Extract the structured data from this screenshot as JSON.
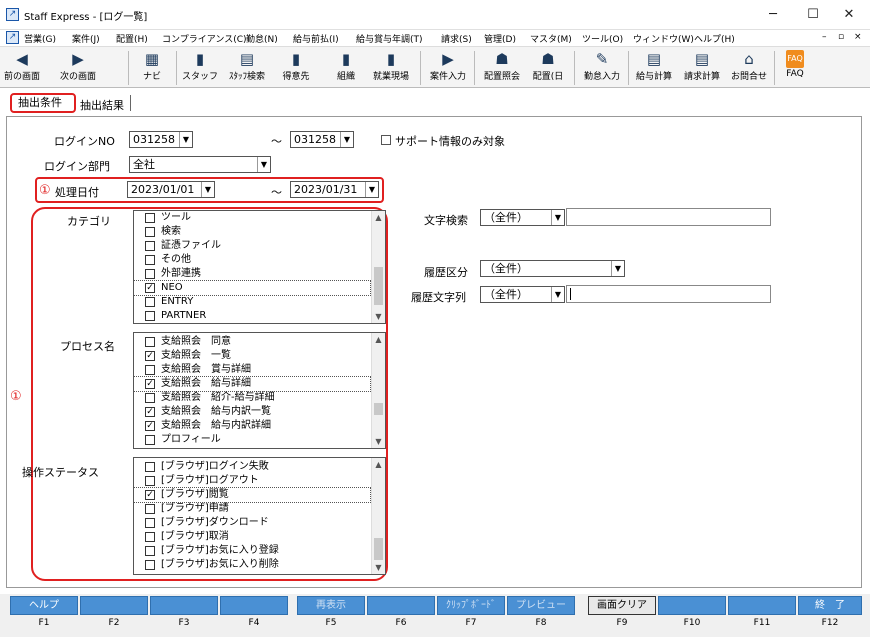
{
  "window": {
    "title": "Staff Express - [ログ一覧]",
    "minimize": "─",
    "maximize": "☐",
    "close": "✕"
  },
  "menu": [
    "営業(G)",
    "案件(J)",
    "配置(H)",
    "コンプライアンス(C)",
    "勤怠(N)",
    "給与前払(I)",
    "給与賞与年調(T)",
    "請求(S)",
    "管理(D)",
    "マスタ(M)",
    "ツール(O)",
    "ウィンドウ(W)",
    "ヘルプ(H)"
  ],
  "mdi_controls": [
    "–",
    "▫",
    "×"
  ],
  "toolbar": [
    {
      "label": "前の画面",
      "icon": "back-arrow-icon",
      "glyph": "◀"
    },
    {
      "label": "次の画面",
      "icon": "forward-arrow-icon",
      "glyph": "▶"
    },
    {
      "label": "ナビ",
      "icon": "navigator-icon",
      "glyph": "▦"
    },
    {
      "label": "スタッフ",
      "icon": "staff-icon",
      "glyph": "▮"
    },
    {
      "label": "ｽﾀｯﾌ検索",
      "icon": "staff-search-icon",
      "glyph": "▤"
    },
    {
      "label": "得意先",
      "icon": "customer-icon",
      "glyph": "▮"
    },
    {
      "label": "組織",
      "icon": "organization-icon",
      "glyph": "▮"
    },
    {
      "label": "就業現場",
      "icon": "workplace-icon",
      "glyph": "▮"
    },
    {
      "label": "案件入力",
      "icon": "case-entry-icon",
      "glyph": "▶"
    },
    {
      "label": "配置照会",
      "icon": "assignment-inquiry-icon",
      "glyph": "☗"
    },
    {
      "label": "配置(日",
      "icon": "daily-assignment-icon",
      "glyph": "☗"
    },
    {
      "label": "勤怠入力",
      "icon": "attendance-entry-icon",
      "glyph": "✎"
    },
    {
      "label": "給与計算",
      "icon": "payroll-calc-icon",
      "glyph": "▤"
    },
    {
      "label": "請求計算",
      "icon": "billing-calc-icon",
      "glyph": "▤"
    },
    {
      "label": "お問合せ",
      "icon": "inquiry-icon",
      "glyph": "⌂"
    },
    {
      "label": "FAQ",
      "icon": "faq-icon",
      "glyph": "FAQ"
    }
  ],
  "tabs": {
    "active": "抽出条件",
    "other": "抽出結果"
  },
  "form": {
    "login_no_label": "ログインNO",
    "login_no_from": "031258",
    "login_no_to": "031258",
    "tilde": "～",
    "support_label": "サポート情報のみ対象",
    "support_checked": false,
    "dept_label": "ログイン部門",
    "dept_value": "全社",
    "date_label": "処理日付",
    "date_from": "2023/01/01",
    "date_to": "2023/01/31",
    "marker": "①",
    "category_label": "カテゴリ",
    "process_label": "プロセス名",
    "status_label": "操作ステータス",
    "text_search_label": "文字検索",
    "text_search_value": "（全件）",
    "history_label": "履歴区分",
    "history_value": "（全件）",
    "history_text_label": "履歴文字列",
    "history_text_value": "（全件）"
  },
  "categories": [
    {
      "text": "ツール",
      "checked": false
    },
    {
      "text": "検索",
      "checked": false
    },
    {
      "text": "証憑ファイル",
      "checked": false
    },
    {
      "text": "その他",
      "checked": false
    },
    {
      "text": "外部連携",
      "checked": false
    },
    {
      "text": "NEO",
      "checked": true
    },
    {
      "text": "ENTRY",
      "checked": false
    },
    {
      "text": "PARTNER",
      "checked": false
    }
  ],
  "processes": [
    {
      "text": "支給照会　同意",
      "checked": false
    },
    {
      "text": "支給照会　一覧",
      "checked": true
    },
    {
      "text": "支給照会　賞与詳細",
      "checked": false
    },
    {
      "text": "支給照会　給与詳細",
      "checked": true
    },
    {
      "text": "支給照会　紹介-給与詳細",
      "checked": false
    },
    {
      "text": "支給照会　給与内訳一覧",
      "checked": true
    },
    {
      "text": "支給照会　給与内訳詳細",
      "checked": true
    },
    {
      "text": "プロフィール",
      "checked": false
    }
  ],
  "statuses": [
    {
      "text": "[ブラウザ]ログイン失敗",
      "checked": false
    },
    {
      "text": "[ブラウザ]ログアウト",
      "checked": false
    },
    {
      "text": "[ブラウザ]閲覧",
      "checked": true
    },
    {
      "text": "[ブラウザ]申請",
      "checked": false
    },
    {
      "text": "[ブラウザ]ダウンロード",
      "checked": false
    },
    {
      "text": "[ブラウザ]取消",
      "checked": false
    },
    {
      "text": "[ブラウザ]お気に入り登録",
      "checked": false
    },
    {
      "text": "[ブラウザ]お気に入り削除",
      "checked": false
    }
  ],
  "fkeys": [
    {
      "label": "ヘルプ",
      "key": "F1",
      "enabled": true
    },
    {
      "label": "",
      "key": "F2",
      "enabled": true
    },
    {
      "label": "",
      "key": "F3",
      "enabled": true
    },
    {
      "label": "",
      "key": "F4",
      "enabled": true
    },
    {
      "label": "再表示",
      "key": "F5",
      "enabled": false
    },
    {
      "label": "",
      "key": "F6",
      "enabled": true
    },
    {
      "label": "ｸﾘｯﾌﾟﾎﾞｰﾄﾞ",
      "key": "F7",
      "enabled": false
    },
    {
      "label": "プレビュー",
      "key": "F8",
      "enabled": false
    },
    {
      "label": "画面クリア",
      "key": "F9",
      "enabled": true,
      "selected": true
    },
    {
      "label": "",
      "key": "F10",
      "enabled": true
    },
    {
      "label": "",
      "key": "F11",
      "enabled": true
    },
    {
      "label": "終　了",
      "key": "F12",
      "enabled": true
    }
  ],
  "colors": {
    "highlight": "#e02020",
    "fkey": "#4a90d4"
  }
}
